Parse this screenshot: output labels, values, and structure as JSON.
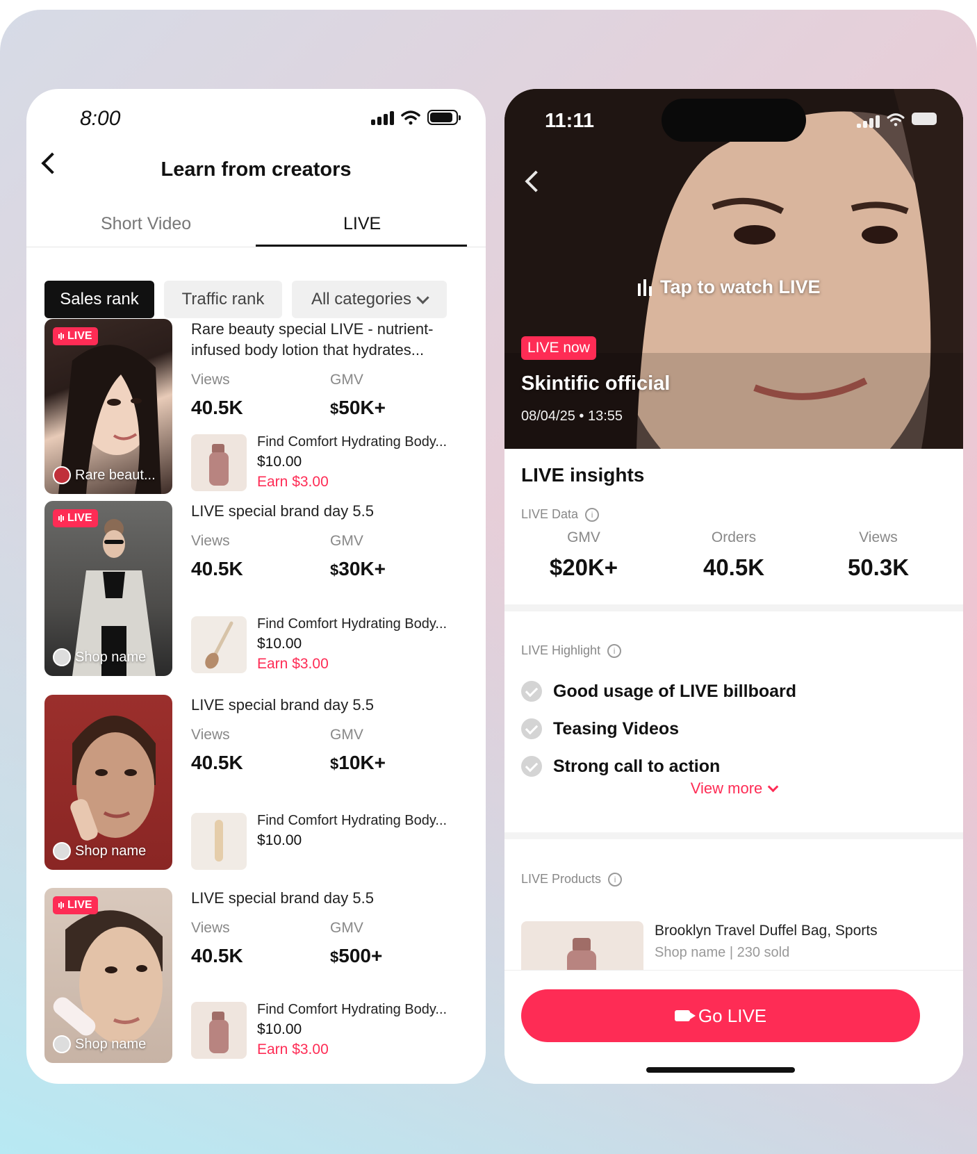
{
  "left": {
    "status_time": "8:00",
    "title": "Learn from creators",
    "tabs": [
      {
        "label": "Short Video"
      },
      {
        "label": "LIVE"
      }
    ],
    "filters": {
      "sales": "Sales rank",
      "traffic": "Traffic rank",
      "categories": "All categories"
    },
    "items": [
      {
        "live_badge": "LIVE",
        "shop": "Rare beaut...",
        "title": "Rare beauty special LIVE - nutrient-infused body lotion that hydrates...",
        "views_label": "Views",
        "views": "40.5K",
        "gmv_label": "GMV",
        "gmv": "50K+",
        "product_title": "Find Comfort Hydrating Body...",
        "price": "$10.00",
        "earn": "Earn $3.00"
      },
      {
        "live_badge": "LIVE",
        "shop": "Shop name",
        "title": "LIVE special brand day 5.5",
        "views_label": "Views",
        "views": "40.5K",
        "gmv_label": "GMV",
        "gmv": "30K+",
        "product_title": "Find Comfort Hydrating Body...",
        "price": "$10.00",
        "earn": "Earn $3.00"
      },
      {
        "live_badge": "",
        "shop": "Shop name",
        "title": "LIVE special brand day 5.5",
        "views_label": "Views",
        "views": "40.5K",
        "gmv_label": "GMV",
        "gmv": "10K+",
        "product_title": "Find Comfort Hydrating Body...",
        "price": "$10.00",
        "earn": ""
      },
      {
        "live_badge": "LIVE",
        "shop": "Shop name",
        "title": "LIVE special brand day 5.5",
        "views_label": "Views",
        "views": "40.5K",
        "gmv_label": "GMV",
        "gmv": "500+",
        "product_title": "Find Comfort Hydrating Body...",
        "price": "$10.00",
        "earn": "Earn $3.00"
      }
    ],
    "currency_symbol": "$"
  },
  "right": {
    "status_time": "11:11",
    "tap_watch": "Tap to watch LIVE",
    "live_now": "LIVE now",
    "creator": "Skintific official",
    "date": "08/04/25 • 13:55",
    "insights_title": "LIVE insights",
    "live_data_label": "LIVE Data",
    "stats": [
      {
        "label": "GMV",
        "value": "$20K+"
      },
      {
        "label": "Orders",
        "value": "40.5K"
      },
      {
        "label": "Views",
        "value": "50.3K"
      }
    ],
    "highlight_label": "LIVE Highlight",
    "highlights": [
      "Good usage of LIVE billboard",
      "Teasing Videos",
      "Strong call to action"
    ],
    "view_more": "View more",
    "products_label": "LIVE Products",
    "product_title": "Brooklyn Travel Duffel Bag, Sports",
    "product_meta": "Shop name | 230 sold",
    "go_live": "Go LIVE"
  },
  "colors": {
    "accent": "#fe2c55",
    "text": "#111111"
  }
}
